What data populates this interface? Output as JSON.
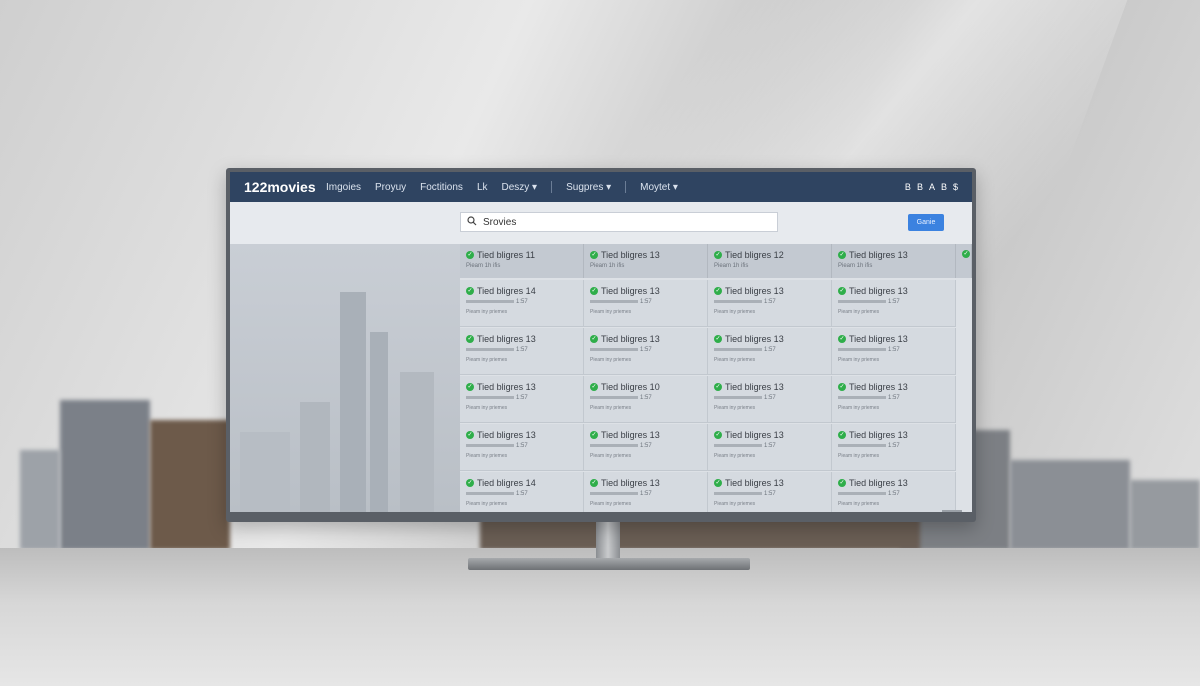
{
  "app": {
    "brand": "122movies",
    "nav": [
      "Imgoies",
      "Proyuy",
      "Foctitions",
      "Lk",
      "Deszy ▾",
      "Sugpres ▾",
      "Moytet ▾"
    ],
    "toolbar_icons": [
      "B",
      "B",
      "A",
      "B",
      "$"
    ],
    "search": {
      "value": "Srovies",
      "button": "Ganie"
    },
    "column_headers": [
      {
        "title": "Tied bligres 11",
        "sub": "Pieam 1h ifis"
      },
      {
        "title": "Tied bligres 13",
        "sub": "Pieam 1h ifis"
      },
      {
        "title": "Tied bligres 12",
        "sub": "Pieam 1h ifis"
      },
      {
        "title": "Tied bligres 13",
        "sub": "Pieam 1h ifis"
      }
    ],
    "rows": [
      [
        "Tied bligres 14",
        "Tied bligres 13",
        "Tied bligres 13",
        "Tied bligres 13"
      ],
      [
        "Tied bligres 13",
        "Tied bligres 13",
        "Tied bligres 13",
        "Tied bligres 13"
      ],
      [
        "Tied bligres 13",
        "Tied bligres 10",
        "Tied bligres 13",
        "Tied bligres 13"
      ],
      [
        "Tied bligres 13",
        "Tied bligres 13",
        "Tied bligres 13",
        "Tied bligres 13"
      ],
      [
        "Tied bligres 14",
        "Tied bligres 13",
        "Tied bligres 13",
        "Tied bligres 13"
      ]
    ],
    "cell_meta": [
      "1:57",
      "1:57",
      "1:57",
      "1:57"
    ],
    "cell_caption": "Pieam iny priemes"
  },
  "colors": {
    "topbar": "#2f4461",
    "accent": "#3b82e0",
    "check": "#2fae4a"
  }
}
